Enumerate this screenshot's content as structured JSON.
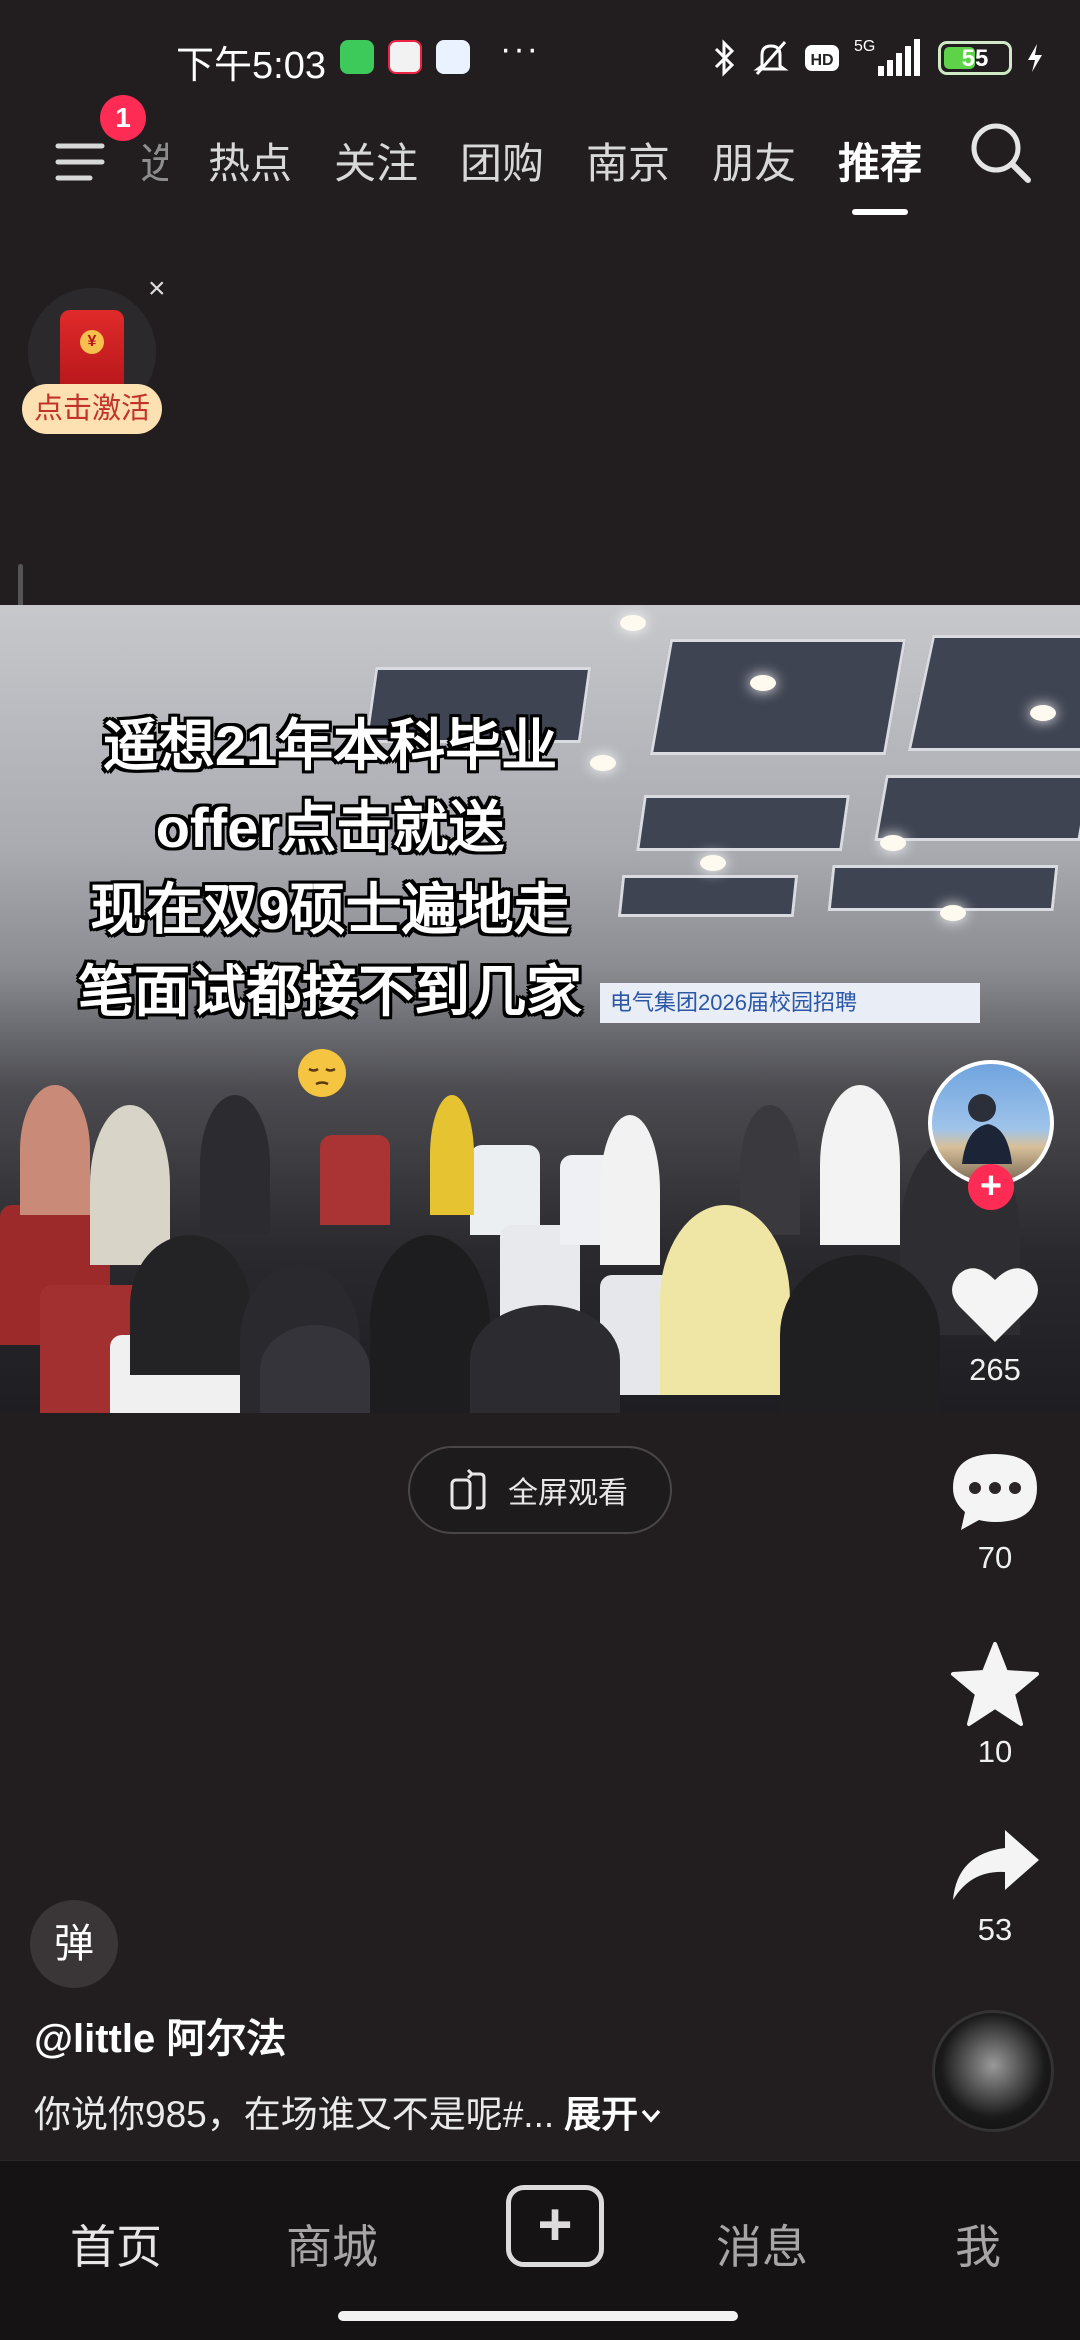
{
  "status_bar": {
    "time": "下午5:03",
    "more": "···",
    "signal_label": "5G",
    "hd_label": "HD",
    "battery_percent": 55,
    "battery_text": "55"
  },
  "top_nav": {
    "badge_count": "1",
    "tabs": [
      {
        "label": "选"
      },
      {
        "label": "热点"
      },
      {
        "label": "关注"
      },
      {
        "label": "团购"
      },
      {
        "label": "南京"
      },
      {
        "label": "朋友"
      },
      {
        "label": "推荐"
      }
    ],
    "active_tab": "推荐"
  },
  "promo": {
    "label": "点击激活",
    "seal": "¥",
    "close": "×"
  },
  "video": {
    "overlay_lines": [
      "遥想21年本科毕业",
      "offer点击就送",
      "现在双9硕士遍地走",
      "笔面试都接不到几家"
    ],
    "banner_text": "电气集团2026届校园招聘"
  },
  "fullscreen": {
    "label": "全屏观看"
  },
  "sidebar": {
    "follow_plus": "+",
    "likes": "265",
    "comments": "70",
    "favorites": "10",
    "shares": "53"
  },
  "post": {
    "danmaku_label": "弹",
    "author": "@little 阿尔法",
    "caption": "你说你985，在场谁又不是呢#...",
    "expand": "展开"
  },
  "bottom_nav": {
    "home": "首页",
    "mall": "商城",
    "add": "+",
    "messages": "消息",
    "me": "我"
  },
  "colors": {
    "background": "#221e1f",
    "accent_red": "#fe2c55",
    "battery_green": "#5ed34a"
  }
}
